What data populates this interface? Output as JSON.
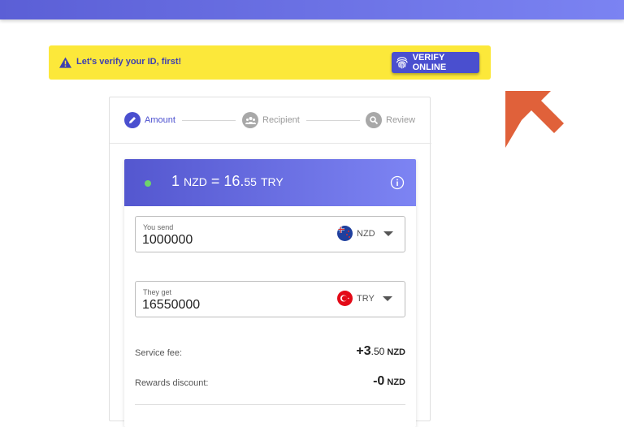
{
  "banner": {
    "message": "Let's verify your ID, first!",
    "verify_label": "VERIFY ONLINE"
  },
  "steps": [
    {
      "label": "Amount",
      "state": "active"
    },
    {
      "label": "Recipient",
      "state": "inactive"
    },
    {
      "label": "Review",
      "state": "inactive"
    }
  ],
  "rate": {
    "base_amount": "1",
    "base_currency": "NZD",
    "equals": "=",
    "rate_main": "16.",
    "rate_decimals": "55",
    "quote_currency": "TRY"
  },
  "send": {
    "label": "You send",
    "value": "1000000",
    "currency": "NZD",
    "flag_icon": "new-zealand-flag-icon"
  },
  "get": {
    "label": "They get",
    "value": "16550000",
    "currency": "TRY",
    "flag_icon": "turkey-flag-icon"
  },
  "fees": {
    "service_label": "Service fee:",
    "service_sign_int": "+3",
    "service_dec": ".50",
    "service_unit": "NZD",
    "rewards_label": "Rewards discount:",
    "rewards_value": "-0",
    "rewards_unit": "NZD"
  },
  "colors": {
    "accent": "#4a4fcf",
    "banner": "#fce83a",
    "arrow": "#e0613a",
    "live": "#6ed36b"
  }
}
